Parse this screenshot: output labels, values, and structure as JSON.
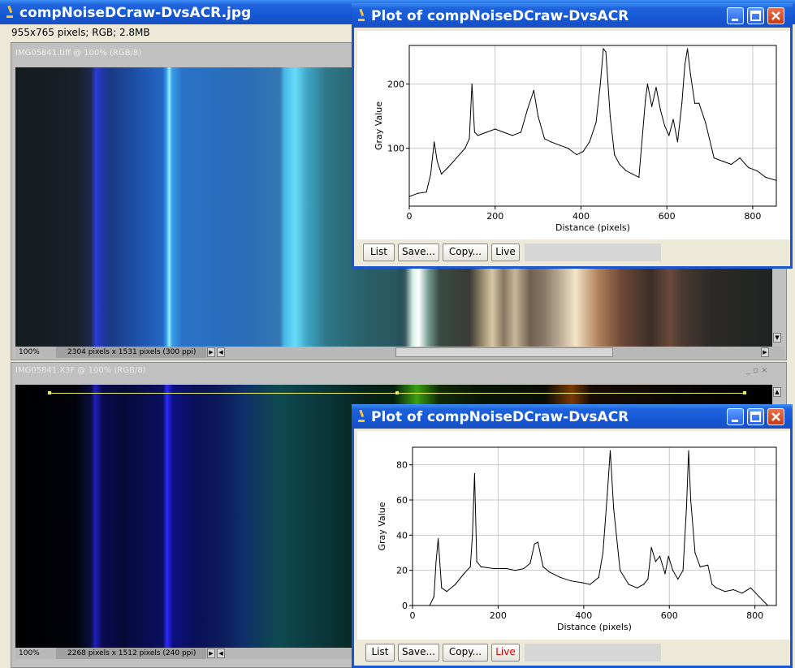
{
  "main_window": {
    "title": "compNoiseDCraw-DvsACR.jpg",
    "info": "955x765 pixels; RGB; 2.8MB"
  },
  "panel_top": {
    "title": "IMG05841.tiff @ 100% (RGB/8)",
    "zoom": "100%",
    "size": "2304 pixels x 1531 pixels (300 ppi)"
  },
  "panel_bottom": {
    "title": "IMG05841.X3F @ 100% (RGB/8)",
    "zoom": "100%",
    "size": "2268 pixels x 1512 pixels (240 ppi)"
  },
  "plot_window_top": {
    "title": "Plot of compNoiseDCraw-DvsACR",
    "buttons": {
      "list": "List",
      "save": "Save...",
      "copy": "Copy...",
      "live": "Live"
    },
    "live_active": false
  },
  "plot_window_bottom": {
    "title": "Plot of compNoiseDCraw-DvsACR",
    "buttons": {
      "list": "List",
      "save": "Save...",
      "copy": "Copy...",
      "live": "Live"
    },
    "live_active": true
  },
  "chart_data": [
    {
      "type": "line",
      "xlabel": "Distance (pixels)",
      "ylabel": "Gray Value",
      "xlim": [
        0,
        855
      ],
      "ylim": [
        10,
        260
      ],
      "xticks": [
        0,
        200,
        400,
        600,
        800
      ],
      "yticks": [
        100,
        200
      ],
      "grid": true,
      "x": [
        0,
        20,
        40,
        50,
        58,
        65,
        75,
        90,
        110,
        130,
        140,
        146,
        152,
        160,
        180,
        200,
        220,
        240,
        260,
        275,
        290,
        300,
        315,
        330,
        350,
        370,
        390,
        405,
        420,
        435,
        445,
        452,
        458,
        468,
        478,
        490,
        505,
        520,
        535,
        550,
        555,
        565,
        575,
        585,
        595,
        605,
        615,
        625,
        635,
        642,
        648,
        655,
        665,
        675,
        690,
        710,
        730,
        750,
        770,
        790,
        810,
        830,
        855
      ],
      "y": [
        25,
        30,
        32,
        60,
        110,
        80,
        60,
        70,
        85,
        100,
        115,
        200,
        125,
        120,
        125,
        130,
        125,
        120,
        125,
        160,
        190,
        150,
        115,
        110,
        105,
        100,
        90,
        95,
        110,
        140,
        200,
        255,
        250,
        150,
        90,
        75,
        65,
        60,
        55,
        175,
        200,
        165,
        195,
        160,
        135,
        120,
        145,
        110,
        170,
        230,
        255,
        215,
        170,
        170,
        140,
        85,
        80,
        75,
        85,
        70,
        65,
        55,
        50
      ]
    },
    {
      "type": "line",
      "xlabel": "Distance (pixels)",
      "ylabel": "Gray Value",
      "xlim": [
        0,
        850
      ],
      "ylim": [
        0,
        90
      ],
      "xticks": [
        0,
        200,
        400,
        600,
        800
      ],
      "yticks": [
        0,
        20,
        40,
        60,
        80
      ],
      "grid": true,
      "x": [
        40,
        50,
        55,
        60,
        68,
        80,
        100,
        120,
        135,
        140,
        145,
        150,
        160,
        190,
        220,
        240,
        260,
        275,
        285,
        293,
        305,
        320,
        345,
        370,
        395,
        415,
        435,
        445,
        455,
        462,
        470,
        485,
        505,
        525,
        540,
        550,
        558,
        568,
        578,
        590,
        598,
        608,
        620,
        632,
        640,
        645,
        650,
        660,
        672,
        690,
        700,
        710,
        730,
        750,
        770,
        790,
        810,
        830
      ],
      "y": [
        0,
        5,
        25,
        38,
        10,
        8,
        12,
        18,
        22,
        40,
        75,
        25,
        22,
        21,
        21,
        20,
        21,
        24,
        35,
        36,
        22,
        19,
        16,
        14,
        13,
        12,
        16,
        30,
        63,
        88,
        55,
        20,
        12,
        10,
        12,
        15,
        33,
        25,
        28,
        18,
        28,
        20,
        15,
        20,
        55,
        88,
        60,
        30,
        22,
        23,
        12,
        10,
        8,
        9,
        7,
        10,
        5,
        0
      ]
    }
  ]
}
